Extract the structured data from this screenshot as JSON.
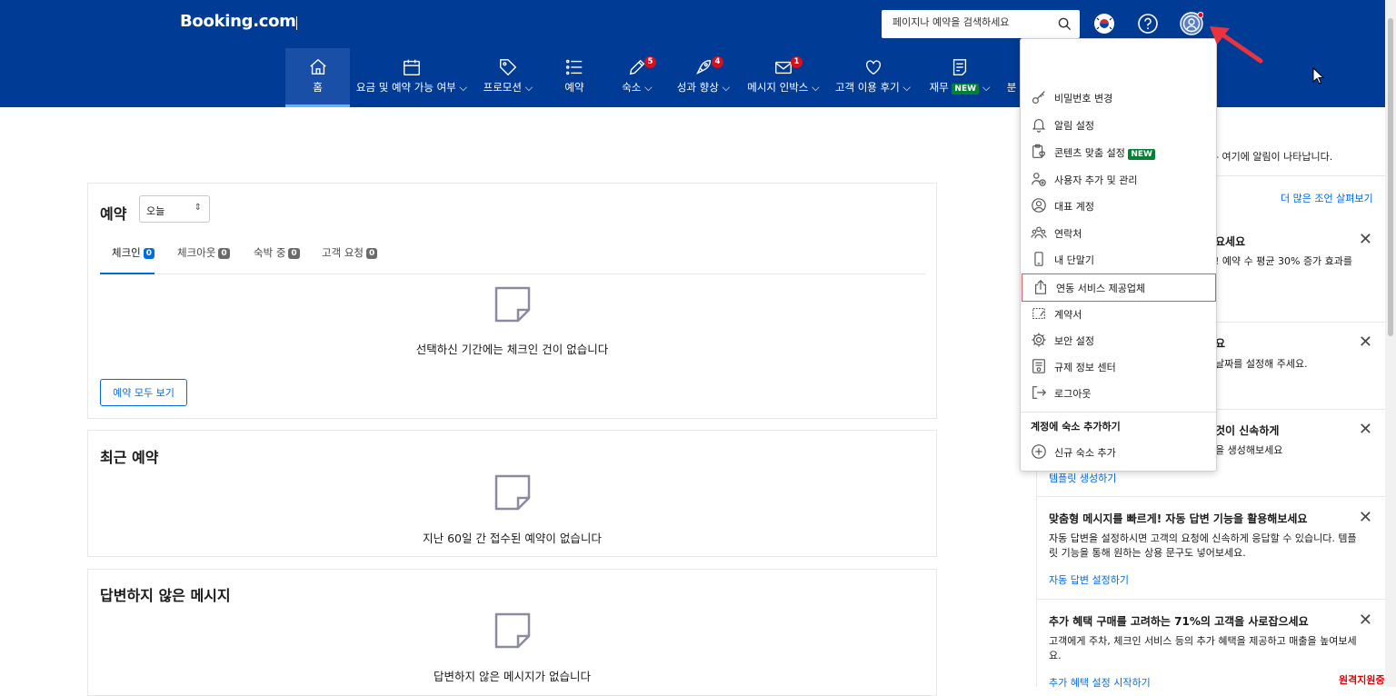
{
  "header": {
    "logo": "Booking.com",
    "search_placeholder": "페이지나 예약을 검색하세요"
  },
  "nav": [
    {
      "label": "홈",
      "icon": "home-icon",
      "active": true
    },
    {
      "label": "요금 및 예약 가능 여부 ⌵",
      "icon": "calendar-icon"
    },
    {
      "label": "프로모션 ⌵",
      "icon": "tag-icon"
    },
    {
      "label": "예약",
      "icon": "list-icon"
    },
    {
      "label": "숙소 ⌵",
      "icon": "pencil-icon",
      "badge": "5"
    },
    {
      "label": "성과 향상 ⌵",
      "icon": "rocket-icon",
      "badge": "4"
    },
    {
      "label": "메시지 인박스 ⌵",
      "icon": "envelope-icon",
      "badge": "1"
    },
    {
      "label": "고객 이용 후기 ⌵",
      "icon": "heart-icon"
    },
    {
      "label": "재무",
      "icon": "document-icon",
      "new": "NEW",
      "suffix": "⌵"
    },
    {
      "label": "분"
    }
  ],
  "reservations": {
    "title": "예약",
    "period": "오늘",
    "tabs": [
      {
        "label": "체크인",
        "count": "0"
      },
      {
        "label": "체크아웃",
        "count": "0"
      },
      {
        "label": "숙박 중",
        "count": "0"
      },
      {
        "label": "고객 요청",
        "count": "0"
      }
    ],
    "empty": "선택하신 기간에는 체크인 건이 없습니다",
    "view_all": "예약 모두 보기"
  },
  "recent": {
    "title": "최근 예약",
    "empty": "지난 60일 간 접수된 예약이 없습니다"
  },
  "unanswered": {
    "title": "답변하지 않은 메시지",
    "empty": "답변하지 않은 메시지가 없습니다"
  },
  "right_panel": {
    "notice_fragment": "- 여기에 알림이 나타납니다.",
    "more_tips": "더 많은 조언 살펴보기",
    "card1_title_fragment": "요세요",
    "card1_text_fragment": "! 예약 수 평균 30% 증가 효과를",
    "card2_title_fragment": "요",
    "card2_text_fragment": "날짜를 설정해 주세요.",
    "card3_title_fragment": "것이 신속하게",
    "card3_text_fragment": "을 생성해보세요",
    "card3_link": "템플릿 생성하기",
    "card4_title": "맞춤형 메시지를 빠르게! 자동 답변 기능을 활용해보세요",
    "card4_text": "자동 답변을 설정하시면 고객의 요청에 신속하게 응답할 수 있습니다. 템플릿 기능을 통해 원하는 상용 문구도 넣어보세요.",
    "card4_link": "자동 답변 설정하기",
    "card5_title": "추가 혜택 구매를 고려하는 71%의 고객을 사로잡으세요",
    "card5_text": "고객에게 주차, 체크인 서비스 등의 추가 혜택을 제공하고 매출을 높여보세요.",
    "card5_link": "추가 혜택 설정 시작하기"
  },
  "account_menu": {
    "items": [
      {
        "label": "비밀번호 변경",
        "icon": "key-icon"
      },
      {
        "label": "알림 설정",
        "icon": "bell-icon"
      },
      {
        "label": "콘텐츠 맞춤 설정",
        "icon": "clipboard-heart-icon",
        "new": "NEW"
      },
      {
        "label": "사용자 추가 및 관리",
        "icon": "user-add-icon"
      },
      {
        "label": "대표 계정",
        "icon": "account-circle-icon"
      },
      {
        "label": "연락처",
        "icon": "contacts-icon"
      },
      {
        "label": "내 단말기",
        "icon": "phone-icon"
      },
      {
        "label": "연동 서비스 제공업체",
        "icon": "share-icon",
        "highlighted": true
      },
      {
        "label": "계약서",
        "icon": "contract-icon"
      },
      {
        "label": "보안 설정",
        "icon": "gear-icon"
      },
      {
        "label": "규제 정보 센터",
        "icon": "regulation-icon"
      },
      {
        "label": "로그아웃",
        "icon": "logout-icon"
      }
    ],
    "section_title": "계정에 숙소 추가하기",
    "add_property": "신규 숙소 추가"
  },
  "overlay": {
    "remote_label": "원격지원중"
  },
  "colors": {
    "header_bg": "#003b95",
    "accent": "#006ce4",
    "badge": "#d4111e",
    "new_badge": "#008234",
    "annotation_red": "#e02020"
  }
}
